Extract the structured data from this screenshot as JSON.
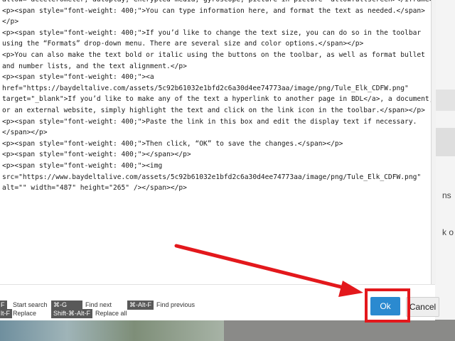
{
  "background": {
    "side_text_1": "ns",
    "side_text_2": "k o"
  },
  "editor": {
    "lines": [
      "allow=\"accelerometer; autoplay; encrypted-media; gyroscope; picture-in-picture\" allowfullscreen></iframe>",
      "<p><span style=\"font-weight: 400;\">You can type information here, and format the text as needed.</span>",
      "</p>",
      "<p><span style=\"font-weight: 400;\">If you’d like to change the text size, you can do so in the toolbar",
      "using the “Formats” drop-down menu. There are several size and color options.</span></p>",
      "<p>You can also make the text bold or italic using the buttons on the toolbar, as well as format bullet",
      "and number lists, and the text alignment.</p>",
      "<p><span style=\"font-weight: 400;\"><a",
      "href=\"https://baydeltalive.com/assets/5c92b61032e1bfd2c6a30d4ee74773aa/image/png/Tule_Elk_CDFW.png\"",
      "target=\"_blank\">If you’d like to make any of the text a hyperlink to another page in BDL</a>, a document,",
      "or an external website, simply highlight the text and click on the link icon in the toolbar.</span></p>",
      "<p><span style=\"font-weight: 400;\">Paste the link in this box and edit the display text if necessary.",
      "</span></p>",
      "<p><span style=\"font-weight: 400;\">Then click, “OK” to save the changes.</span></p>",
      "<p><span style=\"font-weight: 400;\"></span></p>",
      "<p><span style=\"font-weight: 400;\"><img",
      "src=\"https://www.baydeltalive.com/assets/5c92b61032e1bfd2c6a30d4ee74773aa/image/png/Tule_Elk_CDFW.png\"",
      "alt=\"\" width=\"487\" height=\"265\" /></span></p>"
    ]
  },
  "footer": {
    "shortcuts": {
      "start_search_key": "F",
      "start_search_label": "Start search",
      "find_next_key": "⌘-G",
      "find_next_label": "Find next",
      "find_prev_key": "⌘-Alt-F",
      "find_prev_label": "Find previous",
      "replace_key": "lt-F",
      "replace_label": "Replace",
      "replace_all_key": "Shift-⌘-Alt-F",
      "replace_all_label": "Replace all"
    },
    "ok_label": "Ok",
    "cancel_label": "Cancel"
  },
  "colors": {
    "ok_button": "#2b8ad0",
    "highlight": "#e3181c",
    "shortcut_key_bg": "#595959"
  }
}
